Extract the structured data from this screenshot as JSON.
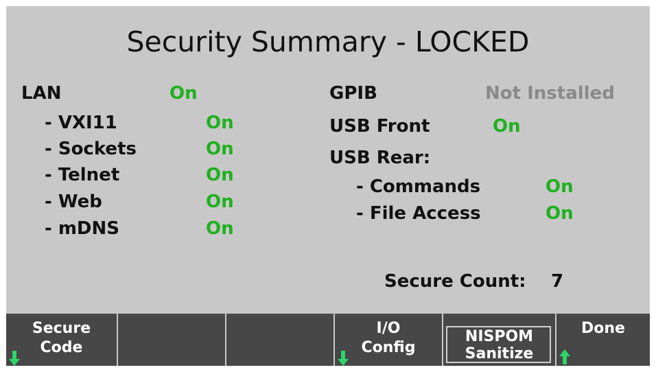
{
  "title": "Security Summary - LOCKED",
  "left": {
    "lan_label": "LAN",
    "lan_value": "On",
    "items": [
      {
        "label": "- VXI11",
        "value": "On"
      },
      {
        "label": "- Sockets",
        "value": "On"
      },
      {
        "label": "- Telnet",
        "value": "On"
      },
      {
        "label": "- Web",
        "value": "On"
      },
      {
        "label": "- mDNS",
        "value": "On"
      }
    ]
  },
  "right": {
    "gpib_label": "GPIB",
    "gpib_value": "Not Installed",
    "usb_front_label": "USB Front",
    "usb_front_value": "On",
    "usb_rear_label": "USB Rear:",
    "commands_label": "- Commands",
    "commands_value": "On",
    "file_access_label": "- File Access",
    "file_access_value": "On"
  },
  "secure_count_label": "Secure Count:",
  "secure_count_value": "7",
  "softkeys": {
    "secure_code_line1": "Secure",
    "secure_code_line2": "Code",
    "io_config_line1": "I/O",
    "io_config_line2": "Config",
    "nispom_line1": "NISPOM",
    "nispom_line2": "Sanitize",
    "done": "Done"
  },
  "colors": {
    "on": "#1fb01f",
    "not_installed": "#8a8a8a",
    "softkey_bg": "#474747",
    "arrow": "#2fd46a"
  }
}
